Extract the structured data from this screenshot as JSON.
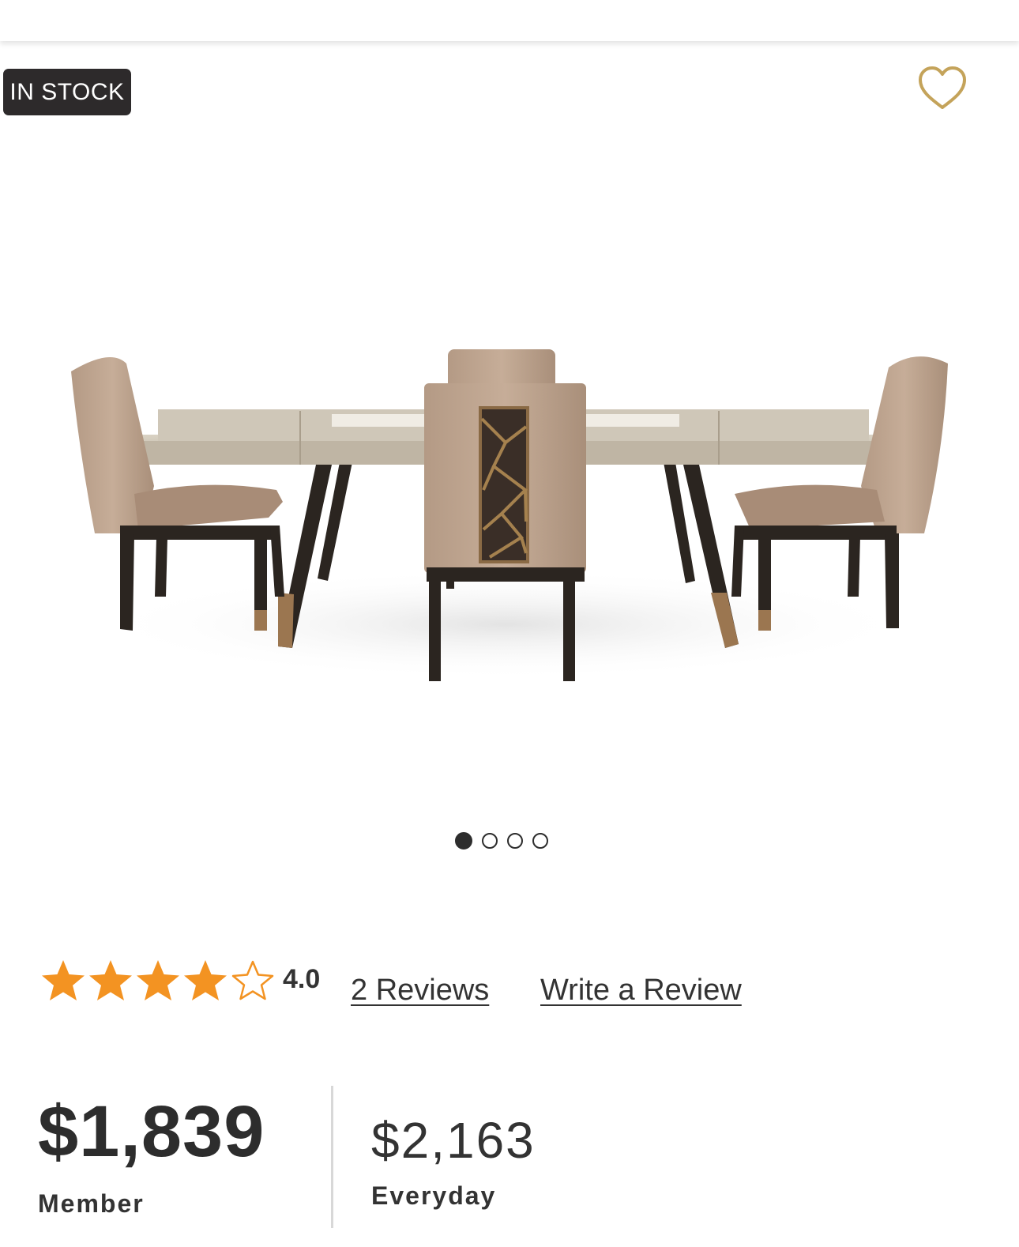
{
  "badge": {
    "stock_label": "IN STOCK"
  },
  "wishlist": {
    "icon": "heart-outline-icon",
    "color": "#c4a35a"
  },
  "product_image": {
    "description_icon": "dining-set-image"
  },
  "carousel": {
    "total": 4,
    "active_index": 0
  },
  "rating": {
    "value_label": "4.0",
    "stars_filled": 4,
    "stars_total": 5,
    "star_color": "#f39322",
    "reviews_label": "2 Reviews",
    "write_review_label": "Write a Review"
  },
  "pricing": {
    "member_price": "$1,839",
    "member_label": "Member",
    "everyday_price": "$2,163",
    "everyday_label": "Everyday"
  }
}
